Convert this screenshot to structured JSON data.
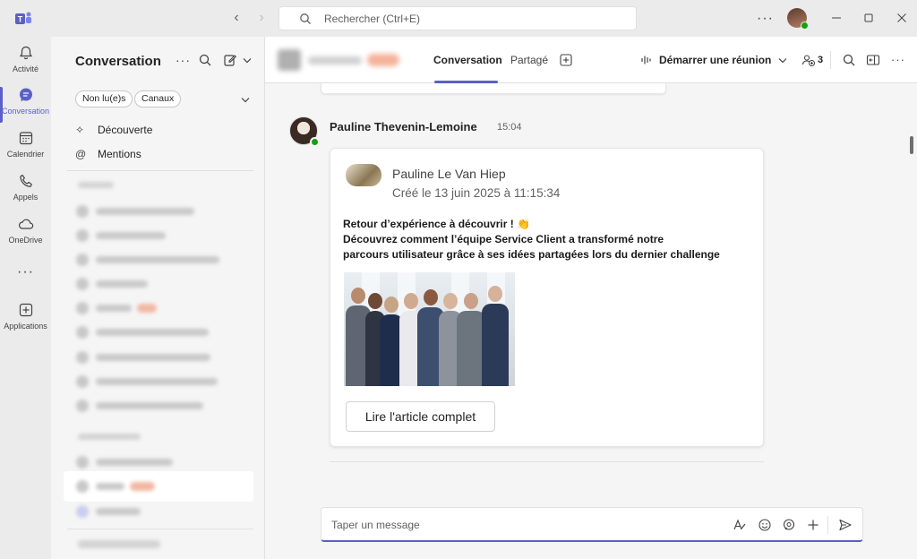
{
  "titlebar": {
    "search_placeholder": "Rechercher (Ctrl+E)",
    "more": "···"
  },
  "rail": [
    {
      "label": "Activité",
      "icon": "bell-icon"
    },
    {
      "label": "Conversation",
      "icon": "chat-icon",
      "active": true
    },
    {
      "label": "Calendrier",
      "icon": "calendar-icon"
    },
    {
      "label": "Appels",
      "icon": "phone-icon"
    },
    {
      "label": "OneDrive",
      "icon": "cloud-icon"
    },
    {
      "label": "···",
      "icon": "more-icon"
    },
    {
      "label": "Applications",
      "icon": "add-apps-icon"
    }
  ],
  "panel": {
    "title": "Conversation",
    "filters": [
      "Non lu(e)s",
      "Canaux"
    ],
    "discover": "Découverte",
    "mentions": "Mentions"
  },
  "main": {
    "tabs": [
      "Conversation",
      "Partagé"
    ],
    "meet_label": "Démarrer une réunion",
    "participants_count": "3",
    "post": {
      "author": "Pauline Thevenin-Lemoine",
      "time": "15:04"
    },
    "card": {
      "name": "Pauline Le Van Hiep",
      "created": "Créé le 13 juin 2025 à 11:15:34",
      "lines": [
        "Retour d’expérience à découvrir ! 👏",
        "Découvrez comment l’équipe Service Client a transformé notre",
        "parcours utilisateur grâce à ses idées partagées lors du dernier challenge"
      ],
      "button": "Lire l'article complet"
    },
    "composer_placeholder": "Taper un message"
  },
  "colors": {
    "accent": "#5b5fc7",
    "presence": "#13a10e"
  }
}
